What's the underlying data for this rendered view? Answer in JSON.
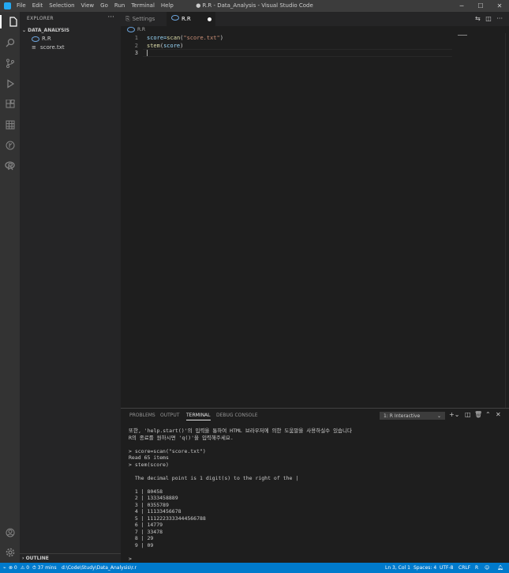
{
  "app": {
    "window_title": "● R.R - Data_Analysis - Visual Studio Code",
    "menus": [
      "File",
      "Edit",
      "Selection",
      "View",
      "Go",
      "Run",
      "Terminal",
      "Help"
    ],
    "window_buttons": [
      "─",
      "☐",
      "✕"
    ],
    "accent": "#007acc"
  },
  "sidebar": {
    "header": "EXPLORER",
    "more": "···",
    "folder": "DATA_ANALYSIS",
    "files": [
      "R.R",
      "score.txt"
    ],
    "outline": "OUTLINE"
  },
  "tabs": [
    {
      "label": "Settings",
      "icon": "settings-file-icon"
    },
    {
      "label": "R.R",
      "icon": "r-file-icon",
      "dirty": true
    }
  ],
  "breadcrumb": "R.R",
  "editor": {
    "line_numbers": [
      "1",
      "2",
      "3"
    ],
    "lines": [
      {
        "pre": "score=",
        "fn": "scan",
        "open": "(",
        "str": "\"score.txt\"",
        "close": ")"
      },
      {
        "fn": "stem",
        "open": "(",
        "arg": "score",
        "close": ")"
      },
      {}
    ]
  },
  "panel": {
    "tabs": [
      "PROBLEMS",
      "OUTPUT",
      "TERMINAL",
      "DEBUG CONSOLE"
    ],
    "active_tab": "TERMINAL",
    "terminal_select": "1: R Interactive",
    "terminal_text": "또한, 'help.start()'의 입력을 통하여 HTML 브라우저에 의한 도움말을 사용하실수 있습니다\nR의 종료를 원하시면 'q()'을 입력해주세요.\n\n> score=scan(\"score.txt\")\nRead 65 items\n> stem(score)\n\n  The decimal point is 1 digit(s) to the right of the |\n\n  1 | 80458\n  2 | 1333458889\n  3 | 0355789\n  4 | 11133456678\n  5 | 1112223333444566788\n  6 | 14779\n  7 | 33478\n  8 | 29\n  9 | 09\n\n> "
  },
  "status": {
    "errors": "⊗ 0",
    "warnings": "⚠ 0",
    "time": "⏱ 37 mins",
    "path": "d:\\Code\\Study\\Data_Analysis\\r.r",
    "position": "Ln 3, Col 1",
    "spaces": "Spaces: 4",
    "encoding": "UTF-8",
    "eol": "CRLF",
    "language": "R"
  }
}
